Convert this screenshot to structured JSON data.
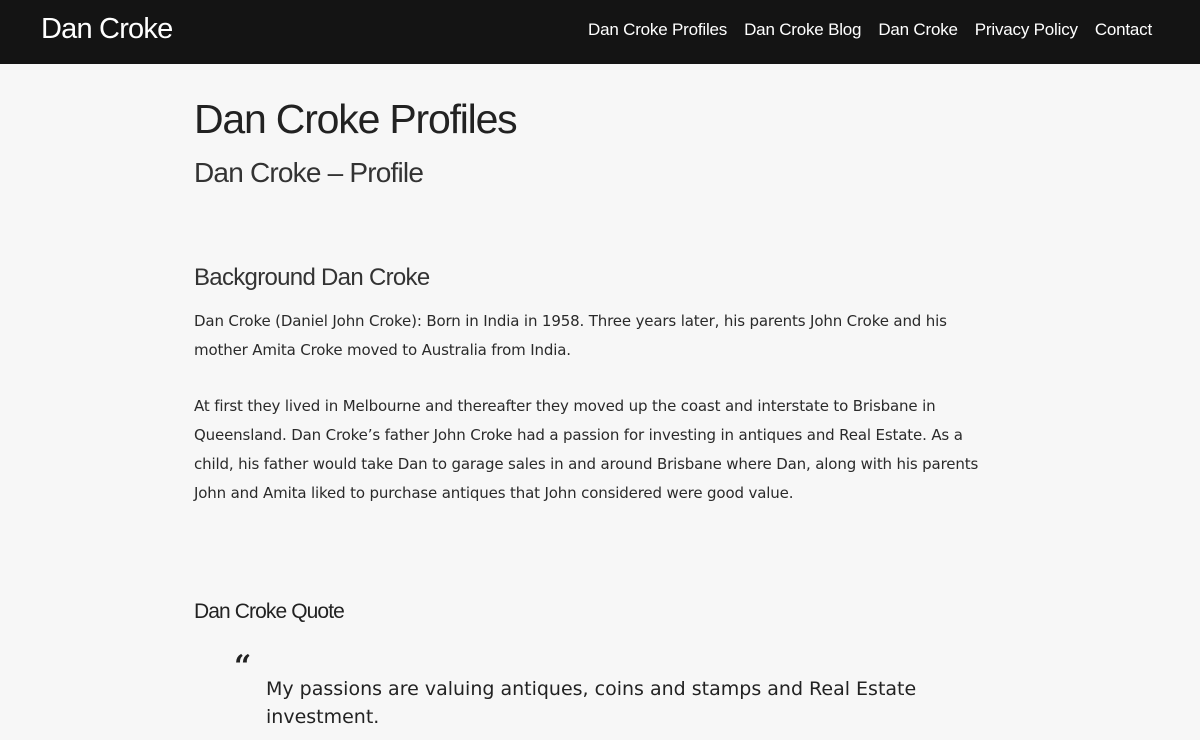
{
  "header": {
    "site_title": "Dan Croke",
    "nav": [
      {
        "label": "Dan Croke Profiles"
      },
      {
        "label": "Dan Croke Blog"
      },
      {
        "label": "Dan Croke"
      },
      {
        "label": "Privacy Policy"
      },
      {
        "label": "Contact"
      }
    ]
  },
  "main": {
    "page_title": "Dan Croke Profiles",
    "page_subtitle": "Dan Croke – Profile",
    "section_heading": "Background Dan Croke",
    "paragraphs": [
      "Dan Croke (Daniel John Croke): Born in India in 1958. Three years later, his parents John Croke and his mother Amita Croke moved to Australia from India.",
      "At first they lived in Melbourne and thereafter they moved up the coast and interstate to Brisbane in Queensland. Dan Croke’s father John Croke had a passion for investing in antiques and Real Estate. As a child, his father would take Dan to garage sales in and around Brisbane where Dan, along with his parents John and Amita liked to purchase antiques that John considered were good value."
    ],
    "quote_heading": "Dan Croke Quote",
    "quote_mark": "“",
    "quote_text": "My passions are valuing antiques, coins and stamps and Real Estate investment."
  },
  "colors": {
    "header_bg": "#141414",
    "page_bg": "#f7f7f7",
    "text": "#222222",
    "header_text": "#ffffff"
  }
}
